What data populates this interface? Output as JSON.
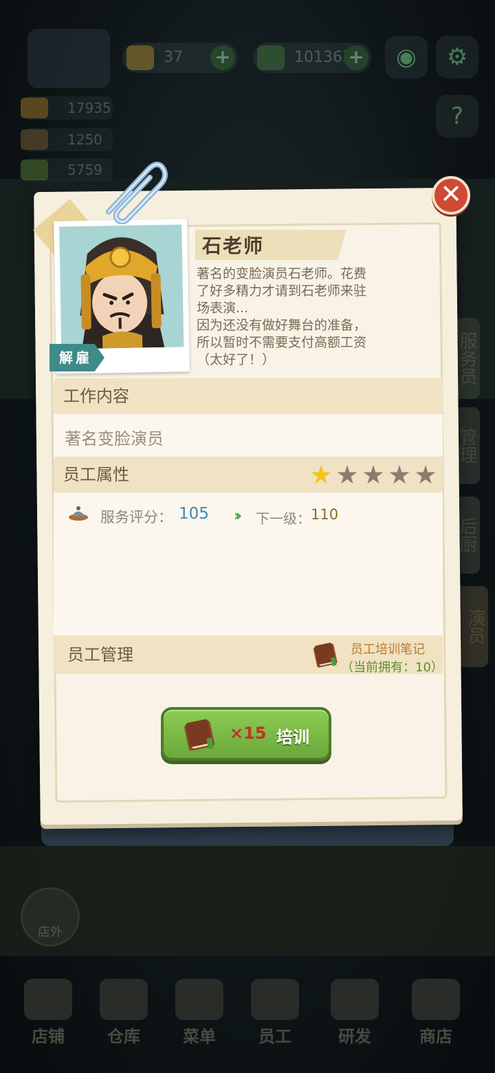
{
  "hud": {
    "gems": "37",
    "cash": "101363",
    "stat1": "17935",
    "stat2": "1250",
    "stat3": "5759"
  },
  "side_tabs": [
    "服务员",
    "管理",
    "后厨",
    "演员"
  ],
  "outside_label": "店外",
  "bottom_nav": [
    "店铺",
    "仓库",
    "菜单",
    "员工",
    "研发",
    "商店"
  ],
  "staff": {
    "name": "石老师",
    "fire_label": "解雇",
    "description_lines": [
      "著名的变脸演员石老师。花费",
      "了好多精力才请到石老师来驻",
      "场表演...",
      "因为还没有做好舞台的准备，",
      "所以暂时不需要支付高额工资",
      "（太好了！）"
    ],
    "job_header": "工作内容",
    "job": "著名变脸演员",
    "attr_header": "员工属性",
    "stars": 1,
    "stars_max": 5,
    "service_label": "服务评分：",
    "service_value": "105",
    "next_label": "下一级：",
    "next_value": "110",
    "manage_header": "员工管理",
    "notes_title": "员工培训笔记",
    "notes_count": "（当前拥有：10）",
    "train_cost": "×15",
    "train_label": "培训"
  },
  "colors": {
    "card": "#f6efdd",
    "accent_green": "#6aa83a",
    "close_red": "#cf4a34",
    "service_blue": "#3a8ab8"
  }
}
